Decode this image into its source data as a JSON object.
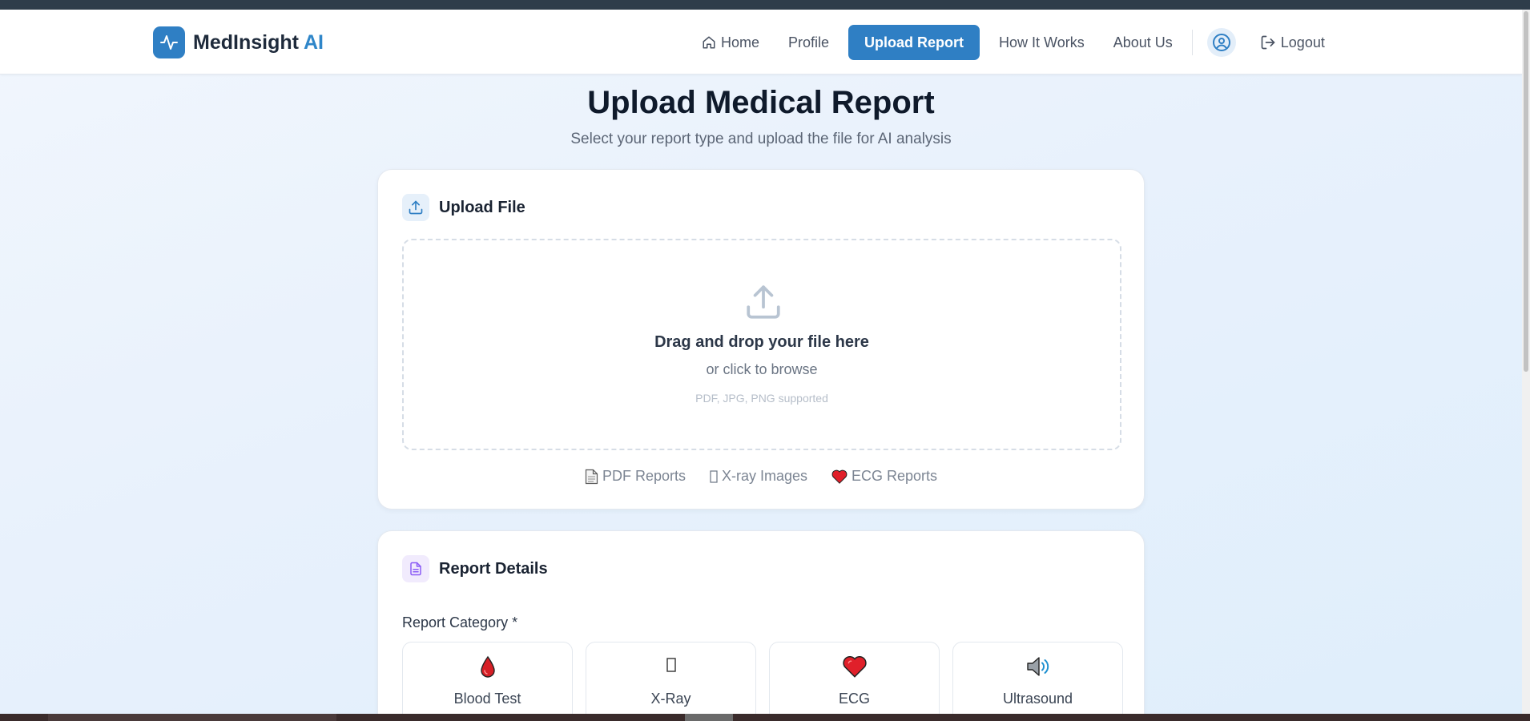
{
  "brand": {
    "name": "MedInsight",
    "accent": "AI"
  },
  "nav": {
    "home": "Home",
    "profile": "Profile",
    "upload": "Upload Report",
    "how": "How It Works",
    "about": "About Us",
    "logout": "Logout"
  },
  "page": {
    "title": "Upload Medical Report",
    "subtitle": "Select your report type and upload the file for AI analysis"
  },
  "upload_card": {
    "title": "Upload File",
    "drop_title": "Drag and drop your file here",
    "drop_sub": "or click to browse",
    "drop_formats": "PDF, JPG, PNG supported",
    "types": [
      {
        "label": "PDF Reports",
        "icon": "document-icon"
      },
      {
        "label": "X-ray Images",
        "icon": "missing-glyph-icon"
      },
      {
        "label": "ECG Reports",
        "icon": "heart-icon"
      }
    ]
  },
  "details_card": {
    "title": "Report Details",
    "category_label": "Report Category",
    "required_mark": "*",
    "categories": [
      {
        "label": "Blood Test",
        "icon": "blood-drop-icon"
      },
      {
        "label": "X-Ray",
        "icon": "missing-glyph-icon"
      },
      {
        "label": "ECG",
        "icon": "heart-icon"
      },
      {
        "label": "Ultrasound",
        "icon": "speaker-icon"
      }
    ]
  },
  "colors": {
    "primary": "#2f7fc4",
    "brand_accent": "#2f86c9",
    "heart": "#e0202a",
    "details_icon": "#8b5cf6"
  }
}
